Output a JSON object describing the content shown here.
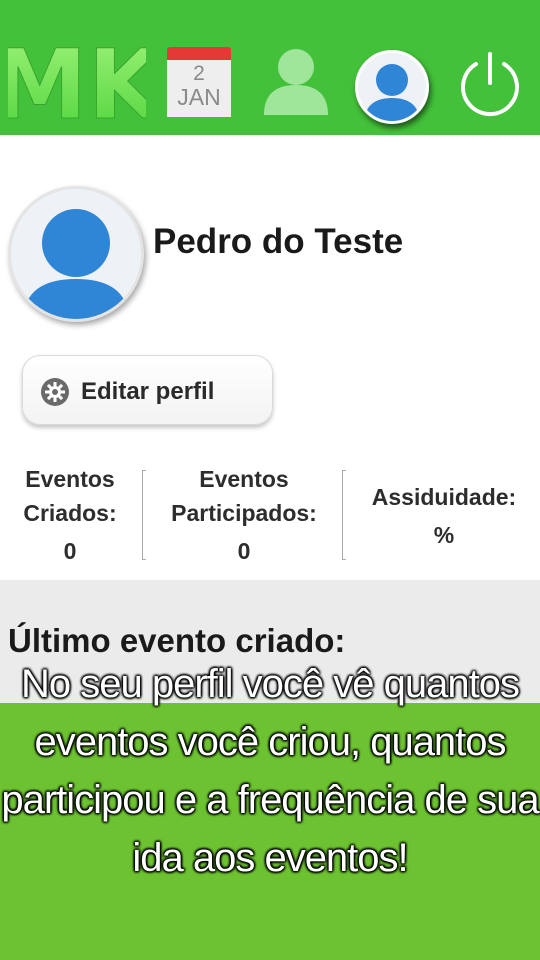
{
  "topbar": {
    "logo_text": "MK",
    "calendar": {
      "day": "2",
      "month": "JAN"
    },
    "icons": [
      "user-icon",
      "avatar-icon",
      "power-icon"
    ],
    "color": "#43c13a"
  },
  "profile": {
    "name": "Pedro do Teste",
    "edit_button_label": "Editar perfil"
  },
  "stats": [
    {
      "label_line1": "Eventos",
      "label_line2": "Criados:",
      "value": "0"
    },
    {
      "label_line1": "Eventos",
      "label_line2": "Participados:",
      "value": "0"
    },
    {
      "label_line1": "Assiduidade:",
      "value": "%"
    }
  ],
  "last_event": {
    "title": "Último evento criado:"
  },
  "promo": {
    "text": "No seu perfil você vê quantos eventos você criou, quantos participou e a frequência de sua ida aos eventos!",
    "color": "#6cc230"
  }
}
